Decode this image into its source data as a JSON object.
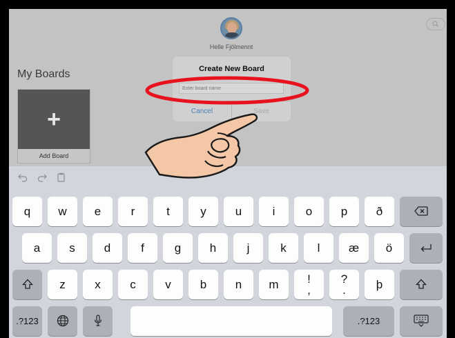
{
  "profile": {
    "name": "Helle Fjölmennt"
  },
  "boards": {
    "title": "My Boards",
    "add_label": "Add Board",
    "add_symbol": "+"
  },
  "dialog": {
    "title": "Create New Board",
    "input_placeholder": "Enter board name",
    "cancel_label": "Cancel",
    "save_label": "Save"
  },
  "keyboard": {
    "row1": [
      "q",
      "w",
      "e",
      "r",
      "t",
      "y",
      "u",
      "i",
      "o",
      "p",
      "ð"
    ],
    "row2": [
      "a",
      "s",
      "d",
      "f",
      "g",
      "h",
      "j",
      "k",
      "l",
      "æ",
      "ö"
    ],
    "row3": [
      "z",
      "x",
      "c",
      "v",
      "b",
      "n",
      "m"
    ],
    "row3_punct1": {
      "top": "!",
      "bottom": ","
    },
    "row3_punct2": {
      "top": "?",
      "bottom": "."
    },
    "row3_last": "þ",
    "numbers_label_left": ".?123",
    "numbers_label_right": ".?123"
  },
  "icons": {
    "search": "search-icon",
    "undo": "undo-icon",
    "redo": "redo-icon",
    "paste": "paste-icon",
    "backspace": "backspace-icon",
    "return": "return-icon",
    "shift": "shift-icon",
    "globe": "globe-icon",
    "mic": "microphone-icon",
    "hide_keyboard": "keyboard-hide-icon"
  },
  "colors": {
    "annotation_red": "#e8121e",
    "hand_fill": "#f4c8a6",
    "link_blue": "#4a7fb5"
  }
}
